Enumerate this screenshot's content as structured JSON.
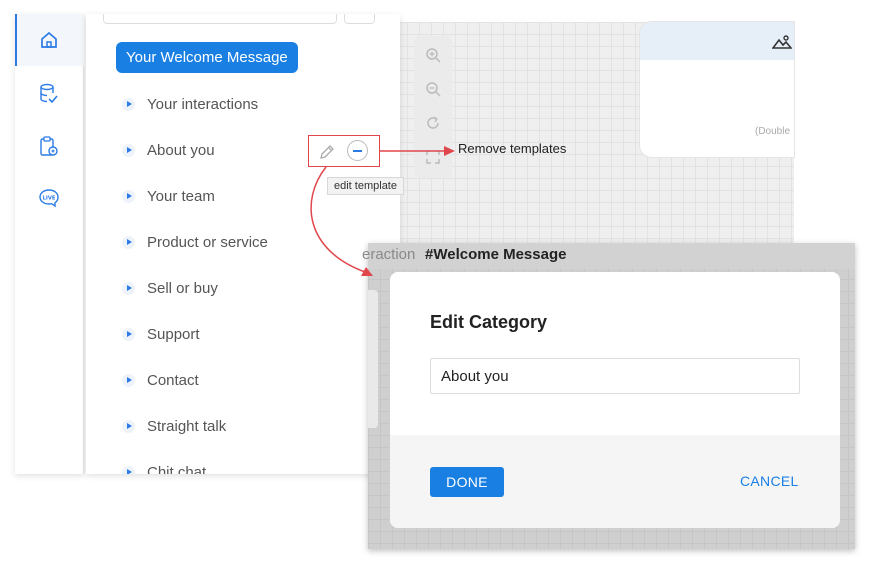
{
  "categories": {
    "welcome_label": "Your Welcome Message",
    "items": [
      {
        "label": "Your interactions"
      },
      {
        "label": "About you"
      },
      {
        "label": "Your team"
      },
      {
        "label": "Product or service"
      },
      {
        "label": "Sell or buy"
      },
      {
        "label": "Support"
      },
      {
        "label": "Contact"
      },
      {
        "label": "Straight talk"
      },
      {
        "label": "Chit chat"
      }
    ]
  },
  "item_actions": {
    "tooltip": "edit template"
  },
  "annotations": {
    "remove_templates": "Remove templates"
  },
  "node": {
    "hint": "(Double"
  },
  "modal": {
    "prefix": "eraction",
    "title": "#Welcome Message"
  },
  "dialog": {
    "title": "Edit Category",
    "input_value": "About you",
    "done_label": "DONE",
    "cancel_label": "CANCEL"
  },
  "rail": {
    "live_label": "LIVE"
  },
  "colors": {
    "accent": "#1a7fe3",
    "annotation_red": "#e0474c"
  }
}
